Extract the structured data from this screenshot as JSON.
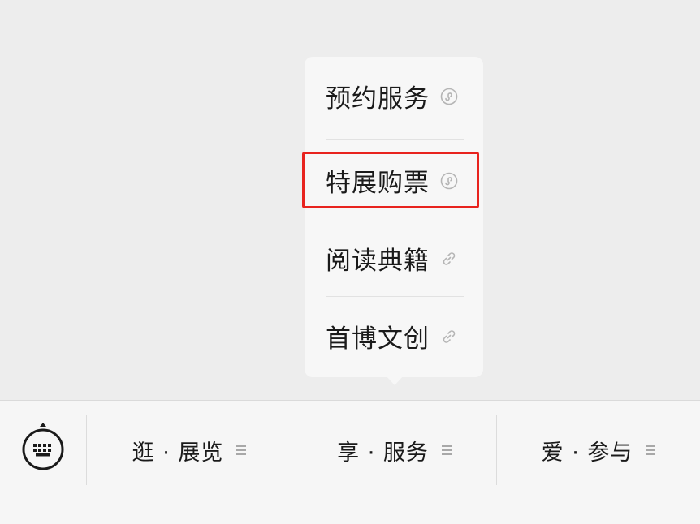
{
  "popup_menu": {
    "items": [
      {
        "label": "预约服务",
        "icon": "mini-program-icon"
      },
      {
        "label": "特展购票",
        "icon": "mini-program-icon"
      },
      {
        "label": "阅读典籍",
        "icon": "link-icon"
      },
      {
        "label": "首博文创",
        "icon": "link-icon"
      }
    ],
    "highlighted_index": 1,
    "highlight_color": "#e8231e"
  },
  "bottom_bar": {
    "keyboard_icon": "keyboard-icon",
    "tabs": [
      {
        "label": "逛 · 展览",
        "icon": "menu-icon"
      },
      {
        "label": "享 · 服务",
        "icon": "menu-icon"
      },
      {
        "label": "爱 · 参与",
        "icon": "menu-icon"
      }
    ]
  }
}
